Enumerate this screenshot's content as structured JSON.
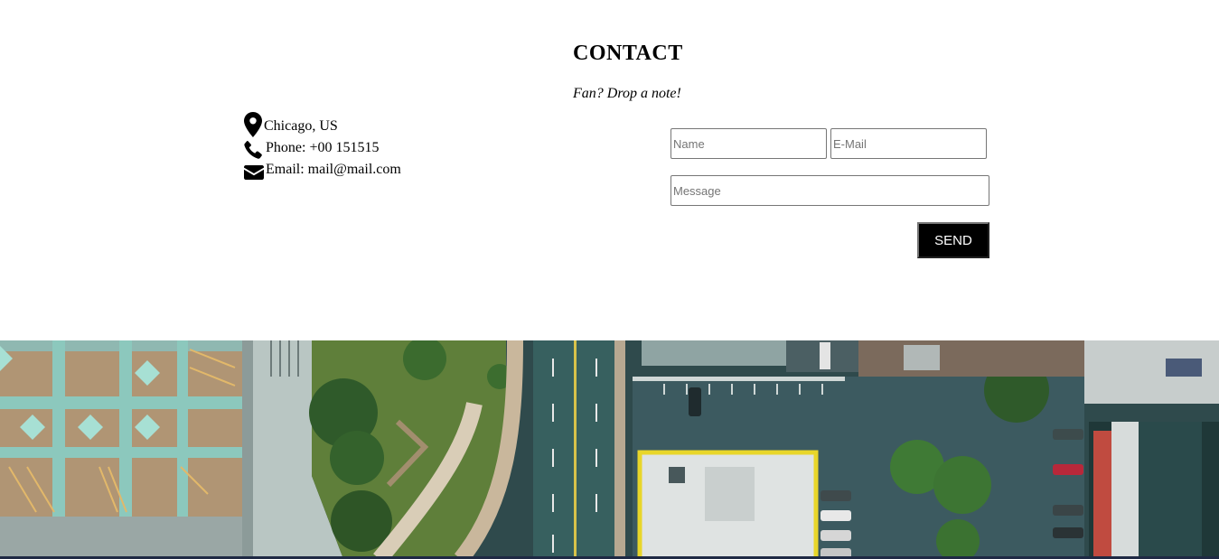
{
  "contact": {
    "title": "CONTACT",
    "subtitle": "Fan? Drop a note!"
  },
  "info": [
    {
      "icon": "map-marker-icon",
      "text": "Chicago, US"
    },
    {
      "icon": "phone-icon",
      "text": "Phone: +00 151515"
    },
    {
      "icon": "envelope-icon",
      "text": "Email: mail@mail.com"
    }
  ],
  "form": {
    "name_placeholder": "Name",
    "email_placeholder": "E-Mail",
    "message_placeholder": "Message",
    "send_label": "SEND"
  },
  "colors": {
    "send_button_bg": "#000000",
    "send_button_text": "#ffffff"
  }
}
